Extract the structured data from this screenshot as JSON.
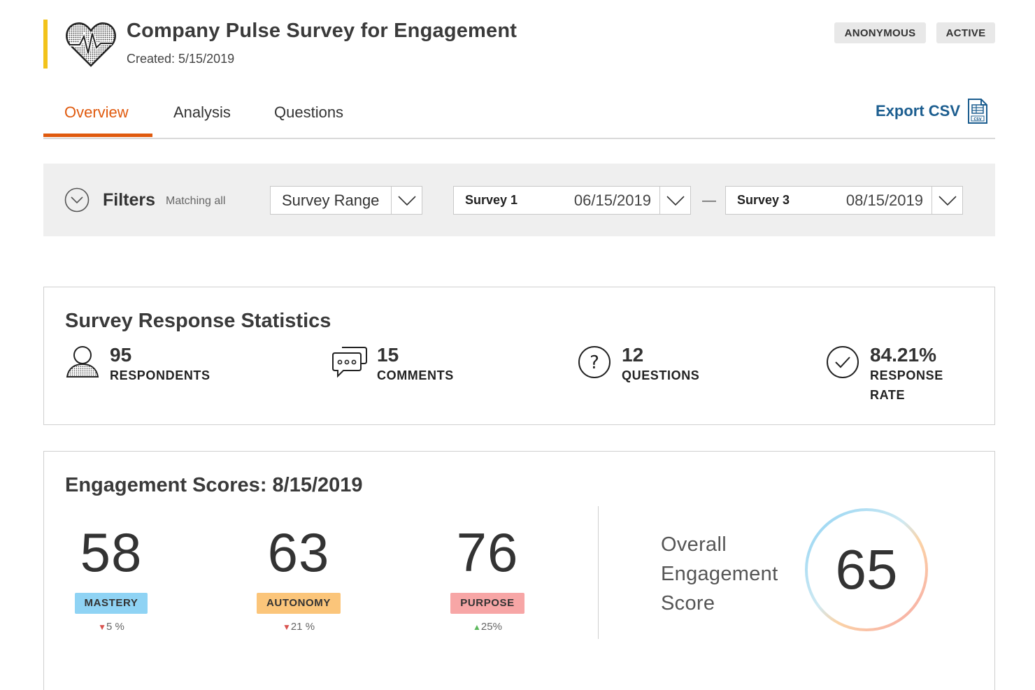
{
  "header": {
    "title": "Company Pulse Survey for Engagement",
    "created": "Created: 5/15/2019",
    "badges": [
      "ANONYMOUS",
      "ACTIVE"
    ],
    "accent_color": "#f2c31b"
  },
  "tabs": {
    "items": [
      {
        "label": "Overview",
        "active": true
      },
      {
        "label": "Analysis",
        "active": false
      },
      {
        "label": "Questions",
        "active": false
      }
    ],
    "export_label": "Export CSV",
    "active_color": "#e05a0e"
  },
  "filters": {
    "label": "Filters",
    "matching": "Matching all",
    "range_select": "Survey Range",
    "start": {
      "name": "Survey 1",
      "date": "06/15/2019"
    },
    "separator": "—",
    "end": {
      "name": "Survey 3",
      "date": "08/15/2019"
    }
  },
  "stats": {
    "title": "Survey Response Statistics",
    "items": [
      {
        "value": "95",
        "label": "RESPONDENTS",
        "icon": "person-icon"
      },
      {
        "value": "15",
        "label": "COMMENTS",
        "icon": "comments-icon"
      },
      {
        "value": "12",
        "label": "QUESTIONS",
        "icon": "question-icon"
      },
      {
        "value": "84.21%",
        "label": "RESPONSE RATE",
        "icon": "check-circle-icon"
      }
    ]
  },
  "engagement": {
    "title": "Engagement Scores: 8/15/2019",
    "scores": [
      {
        "value": "58",
        "label": "MASTERY",
        "change": "5 %",
        "direction": "down",
        "color": "#8fd3f4"
      },
      {
        "value": "63",
        "label": "AUTONOMY",
        "change": "21 %",
        "direction": "down",
        "color": "#fbc57a"
      },
      {
        "value": "76",
        "label": "PURPOSE",
        "change": "25%",
        "direction": "up",
        "color": "#f7a6a6"
      }
    ],
    "overall_label": "Overall Engagement Score",
    "overall_value": "65"
  }
}
